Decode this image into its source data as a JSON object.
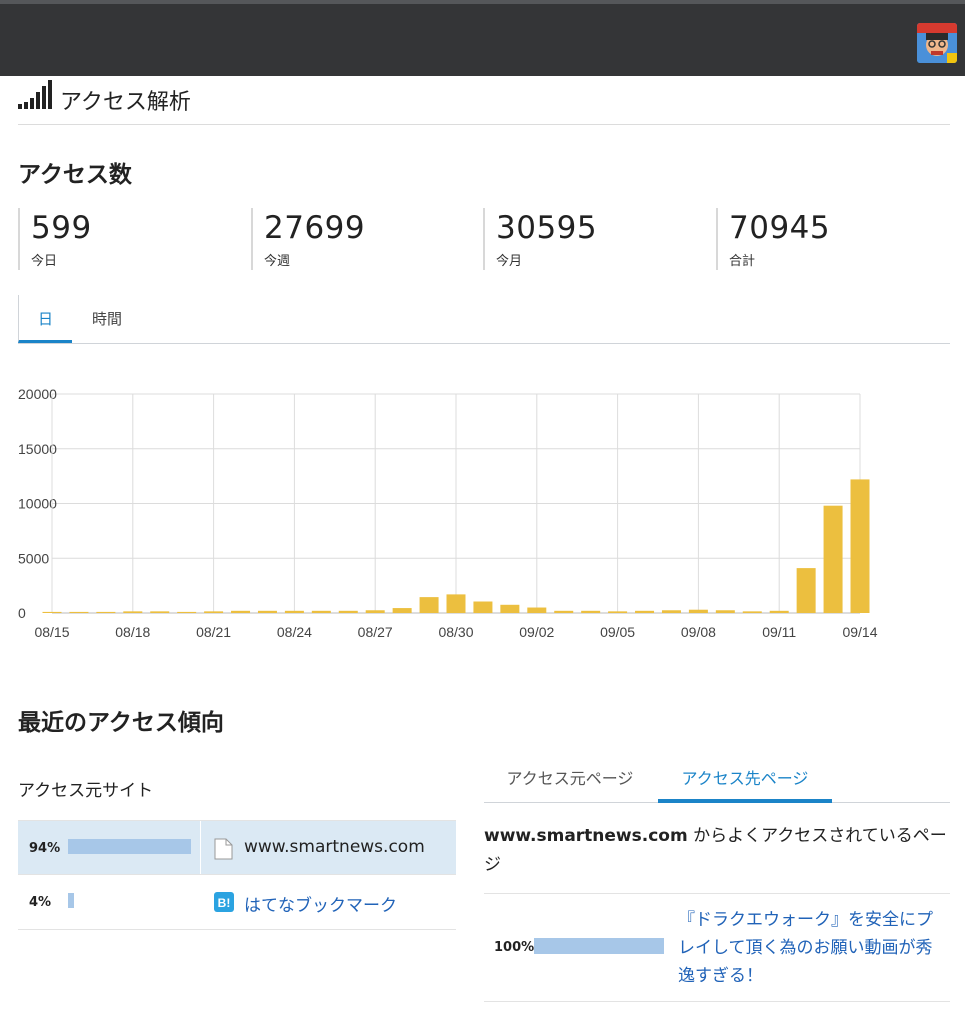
{
  "page": {
    "title": "アクセス解析"
  },
  "access_count": {
    "heading": "アクセス数",
    "stats": [
      {
        "value": "599",
        "label": "今日"
      },
      {
        "value": "27699",
        "label": "今週"
      },
      {
        "value": "30595",
        "label": "今月"
      },
      {
        "value": "70945",
        "label": "合計"
      }
    ]
  },
  "period_tabs": [
    {
      "label": "日",
      "active": true
    },
    {
      "label": "時間",
      "active": false
    }
  ],
  "chart_data": {
    "type": "bar",
    "title": "",
    "xlabel": "",
    "ylabel": "",
    "ylim": [
      0,
      20000
    ],
    "y_ticks": [
      "20000",
      "15000",
      "10000",
      "5000",
      "0"
    ],
    "x_tick_labels": [
      "08/15",
      "08/18",
      "08/21",
      "08/24",
      "08/27",
      "08/30",
      "09/02",
      "09/05",
      "09/08",
      "09/11",
      "09/14"
    ],
    "grid": true,
    "bar_color": "#ecbf3f",
    "categories": [
      "08/15",
      "08/16",
      "08/17",
      "08/18",
      "08/19",
      "08/20",
      "08/21",
      "08/22",
      "08/23",
      "08/24",
      "08/25",
      "08/26",
      "08/27",
      "08/28",
      "08/29",
      "08/30",
      "08/31",
      "09/01",
      "09/02",
      "09/03",
      "09/04",
      "09/05",
      "09/06",
      "09/07",
      "09/08",
      "09/09",
      "09/10",
      "09/11",
      "09/12",
      "09/13",
      "09/14"
    ],
    "values": [
      100,
      100,
      100,
      150,
      150,
      100,
      150,
      200,
      200,
      200,
      200,
      200,
      250,
      450,
      1450,
      1700,
      1050,
      750,
      500,
      200,
      200,
      150,
      200,
      250,
      300,
      250,
      150,
      200,
      4100,
      9800,
      12200
    ]
  },
  "trends": {
    "heading": "最近のアクセス傾向",
    "sources_heading": "アクセス元サイト",
    "sources": [
      {
        "pct_label": "94%",
        "pct": 94,
        "name": "www.smartnews.com",
        "icon": "document-icon",
        "link": false
      },
      {
        "pct_label": "4%",
        "pct": 4,
        "name": "はてなブックマーク",
        "icon": "hatena-bookmark-icon",
        "link": true
      }
    ],
    "page_tabs": [
      {
        "label": "アクセス元ページ",
        "active": false
      },
      {
        "label": "アクセス先ページ",
        "active": true
      }
    ],
    "dest_heading_site": "www.smartnews.com",
    "dest_heading_rest": " からよくアクセスされているページ",
    "destinations": [
      {
        "pct_label": "100%",
        "pct": 100,
        "title": "『ドラクエウォーク』を安全にプレイして頂く為のお願い動画が秀逸すぎる！"
      }
    ]
  },
  "colors": {
    "accent": "#1b84c8",
    "bar": "#ecbf3f",
    "ratio_bar": "#a7c7e8",
    "link": "#2163b8",
    "topbar": "#343537"
  }
}
